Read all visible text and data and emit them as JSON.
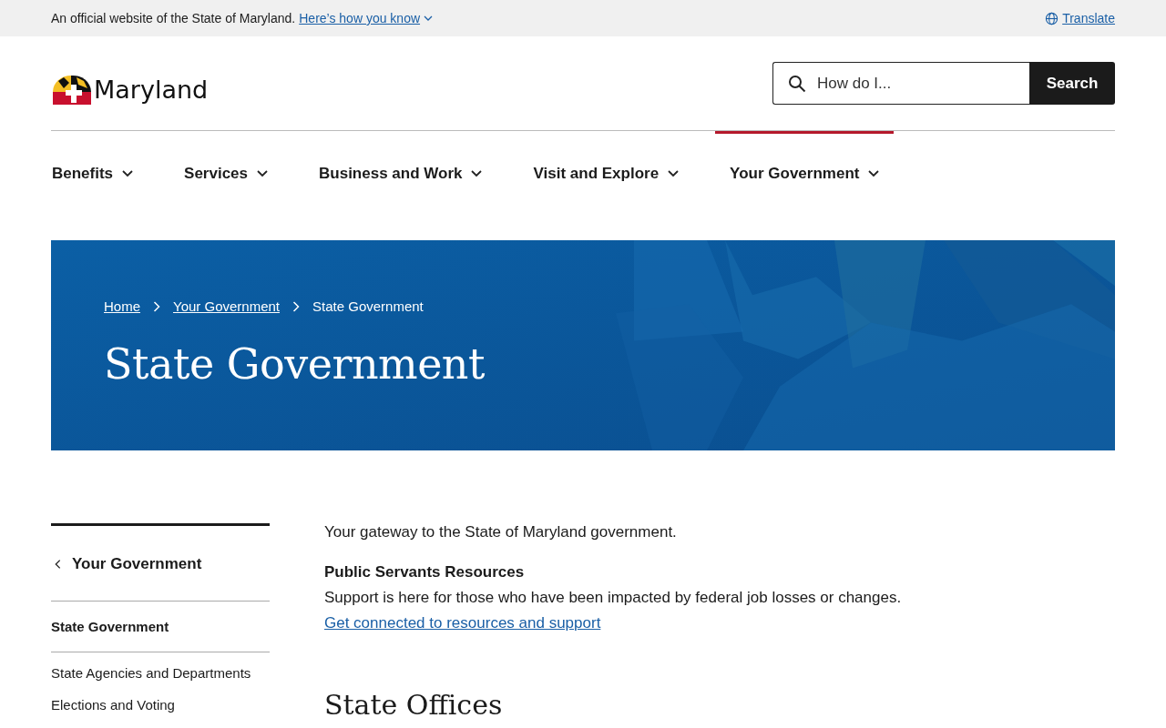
{
  "banner": {
    "text": "An official website of the State of Maryland.",
    "link": "Here’s how you know",
    "translate": "Translate"
  },
  "header": {
    "logo": "Maryland",
    "search": {
      "placeholder": "How do I...",
      "button": "Search"
    }
  },
  "nav": [
    {
      "label": "Benefits",
      "selected": false
    },
    {
      "label": "Services",
      "selected": false
    },
    {
      "label": "Business and Work",
      "selected": false
    },
    {
      "label": "Visit and Explore",
      "selected": false
    },
    {
      "label": "Your Government",
      "selected": true
    }
  ],
  "hero": {
    "kind": "picture",
    "breadcrumbs": [
      {
        "label": "Home",
        "link": true
      },
      {
        "label": "Your Government",
        "link": true
      },
      {
        "label": "State Government",
        "link": false
      }
    ],
    "title": "State Government"
  },
  "sidebar": {
    "parent": "Your Government",
    "items": [
      {
        "label": "State Government",
        "selected": true
      },
      {
        "label": "State Agencies and Departments",
        "selected": false
      },
      {
        "label": "Elections and Voting",
        "selected": false
      }
    ]
  },
  "content": {
    "intro": "Your gateway to the State of Maryland government.",
    "notice_title": "Public Servants Resources",
    "notice_text": "Support is here for those who have been impacted by federal job losses or changes.",
    "notice_link": "Get connected to resources and support",
    "heading": "State Offices"
  }
}
